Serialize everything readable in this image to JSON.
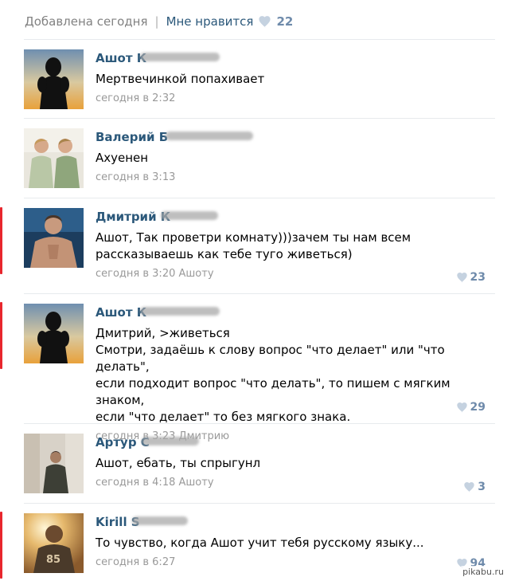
{
  "header": {
    "added": "Добавлена сегодня",
    "separator": "|",
    "like_label": "Мне нравится",
    "like_count": "22"
  },
  "comments": [
    {
      "author": "Ашот К",
      "text": "Мертвечинкой попахивает",
      "time": "сегодня в 2:32",
      "reply_to": "",
      "likes": "",
      "highlight": false
    },
    {
      "author": "Валерий Б",
      "text": "Ахуенен",
      "time": "сегодня в 3:13",
      "reply_to": "",
      "likes": "",
      "highlight": false
    },
    {
      "author": "Дмитрий К",
      "text": "Ашот, Так проветри комнату)))зачем ты нам всем\nрассказываешь как тебе туго живеться)",
      "time": "сегодня в 3:20",
      "reply_to": "Ашоту",
      "likes": "23",
      "highlight": true
    },
    {
      "author": "Ашот К",
      "text": "Дмитрий, >живеться\nСмотри, задаёшь к слову вопрос \"что делает\" или \"что делать\",\nесли подходит вопрос \"что делать\", то пишем с мягким знаком,\nесли \"что делает\" то без мягкого знака.",
      "time": "сегодня в 3:23",
      "reply_to": "Дмитрию",
      "likes": "29",
      "highlight": true
    },
    {
      "author": "Артур С",
      "text": "Ашот, ебать, ты спрыгунл",
      "time": "сегодня в 4:18",
      "reply_to": "Ашоту",
      "likes": "3",
      "highlight": false
    },
    {
      "author": "Kirill S",
      "text": "То чувство, когда Ашот учит тебя русскому языку...",
      "time": "сегодня в 6:27",
      "reply_to": "",
      "likes": "94",
      "highlight": true
    }
  ],
  "watermark": "pikabu.ru",
  "colors": {
    "link": "#2b587a",
    "meta": "#999999",
    "like_count": "#6f8bab",
    "heart": "#c5d2e0",
    "highlight_bar": "#e8262d",
    "divider": "#e7eaed"
  },
  "icons": {
    "heart": "heart-icon"
  }
}
